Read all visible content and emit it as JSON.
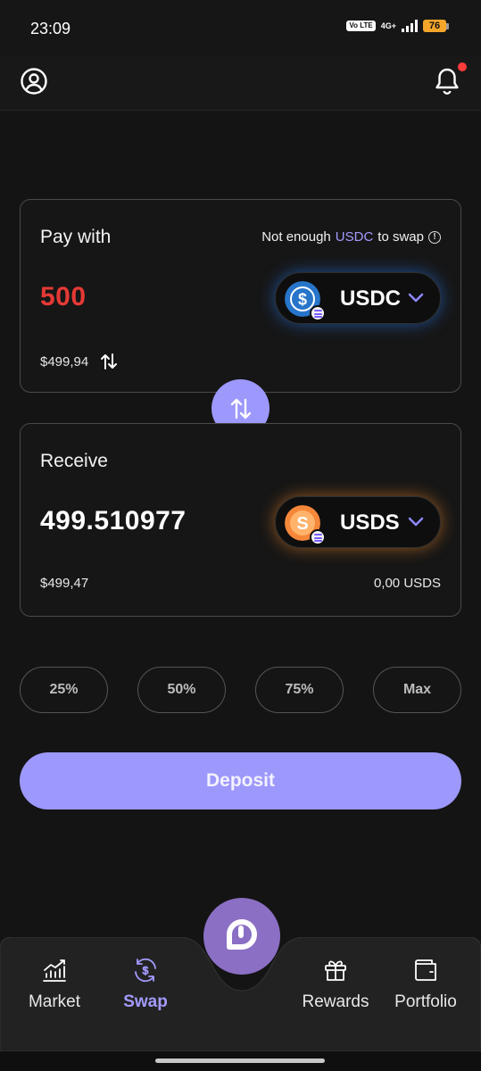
{
  "status_bar": {
    "time": "23:09",
    "network_badge": "Vo LTE",
    "network_type": "4G+",
    "battery": "76"
  },
  "header": {
    "profile_icon": "user-circle-icon",
    "notifications_icon": "bell-icon",
    "has_notification_dot": true
  },
  "pay": {
    "title": "Pay with",
    "warning_prefix": "Not enough",
    "warning_token": "USDC",
    "warning_suffix": "to swap",
    "amount": "500",
    "fiat_value": "$499,94",
    "token": "USDC",
    "token_color": "#2775ca"
  },
  "receive": {
    "title": "Receive",
    "amount": "499.510977",
    "fiat_value": "$499,47",
    "balance": "0,00 USDS",
    "token": "USDS",
    "token_color": "#f5873a"
  },
  "percent_buttons": [
    "25%",
    "50%",
    "75%",
    "Max"
  ],
  "deposit_label": "Deposit",
  "nav": {
    "items": [
      {
        "label": "Market",
        "icon": "chart-icon"
      },
      {
        "label": "Swap",
        "icon": "swap-icon",
        "active": true
      },
      {
        "label": "Rewards",
        "icon": "gift-icon"
      },
      {
        "label": "Portfolio",
        "icon": "wallet-icon"
      }
    ]
  },
  "colors": {
    "accent": "#9d98fb",
    "error": "#e53935",
    "background": "#141414"
  }
}
